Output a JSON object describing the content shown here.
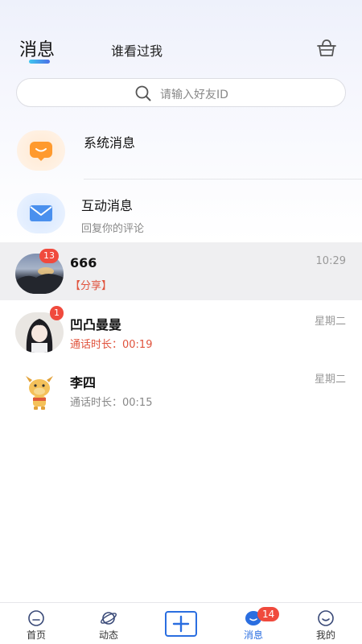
{
  "header": {
    "tab_messages": "消息",
    "tab_who_viewed": "谁看过我"
  },
  "search": {
    "placeholder": "请输入好友ID"
  },
  "system": {
    "title": "系统消息"
  },
  "interaction": {
    "title": "互动消息",
    "subtitle": "回复你的评论"
  },
  "chats": [
    {
      "name": "666",
      "preview": "【分享】",
      "time": "10:29",
      "badge": "13",
      "preview_color": "#e0533d"
    },
    {
      "name": "凹凸曼曼",
      "preview": "通话时长：00:19",
      "time": "星期二",
      "badge": "1",
      "preview_color": "#e0533d"
    },
    {
      "name": "李四",
      "preview": "通话时长：00:15",
      "time": "星期二",
      "badge": "",
      "preview_color": "#888888"
    }
  ],
  "nav": {
    "home": "首页",
    "moments": "动态",
    "messages": "消息",
    "messages_badge": "14",
    "mine": "我的"
  },
  "colors": {
    "accent": "#2a6ee0",
    "badge": "#f04a3d",
    "system_icon": "#ff9a2e",
    "interaction_icon": "#4a90ee"
  },
  "icons": {
    "basket": "basket-icon",
    "search": "search-icon",
    "system": "chat-bubble-icon",
    "interaction": "envelope-icon",
    "home": "home-icon",
    "moments": "planet-icon",
    "add": "plus-icon",
    "messages": "chat-bubble-icon",
    "mine": "smiley-icon"
  }
}
